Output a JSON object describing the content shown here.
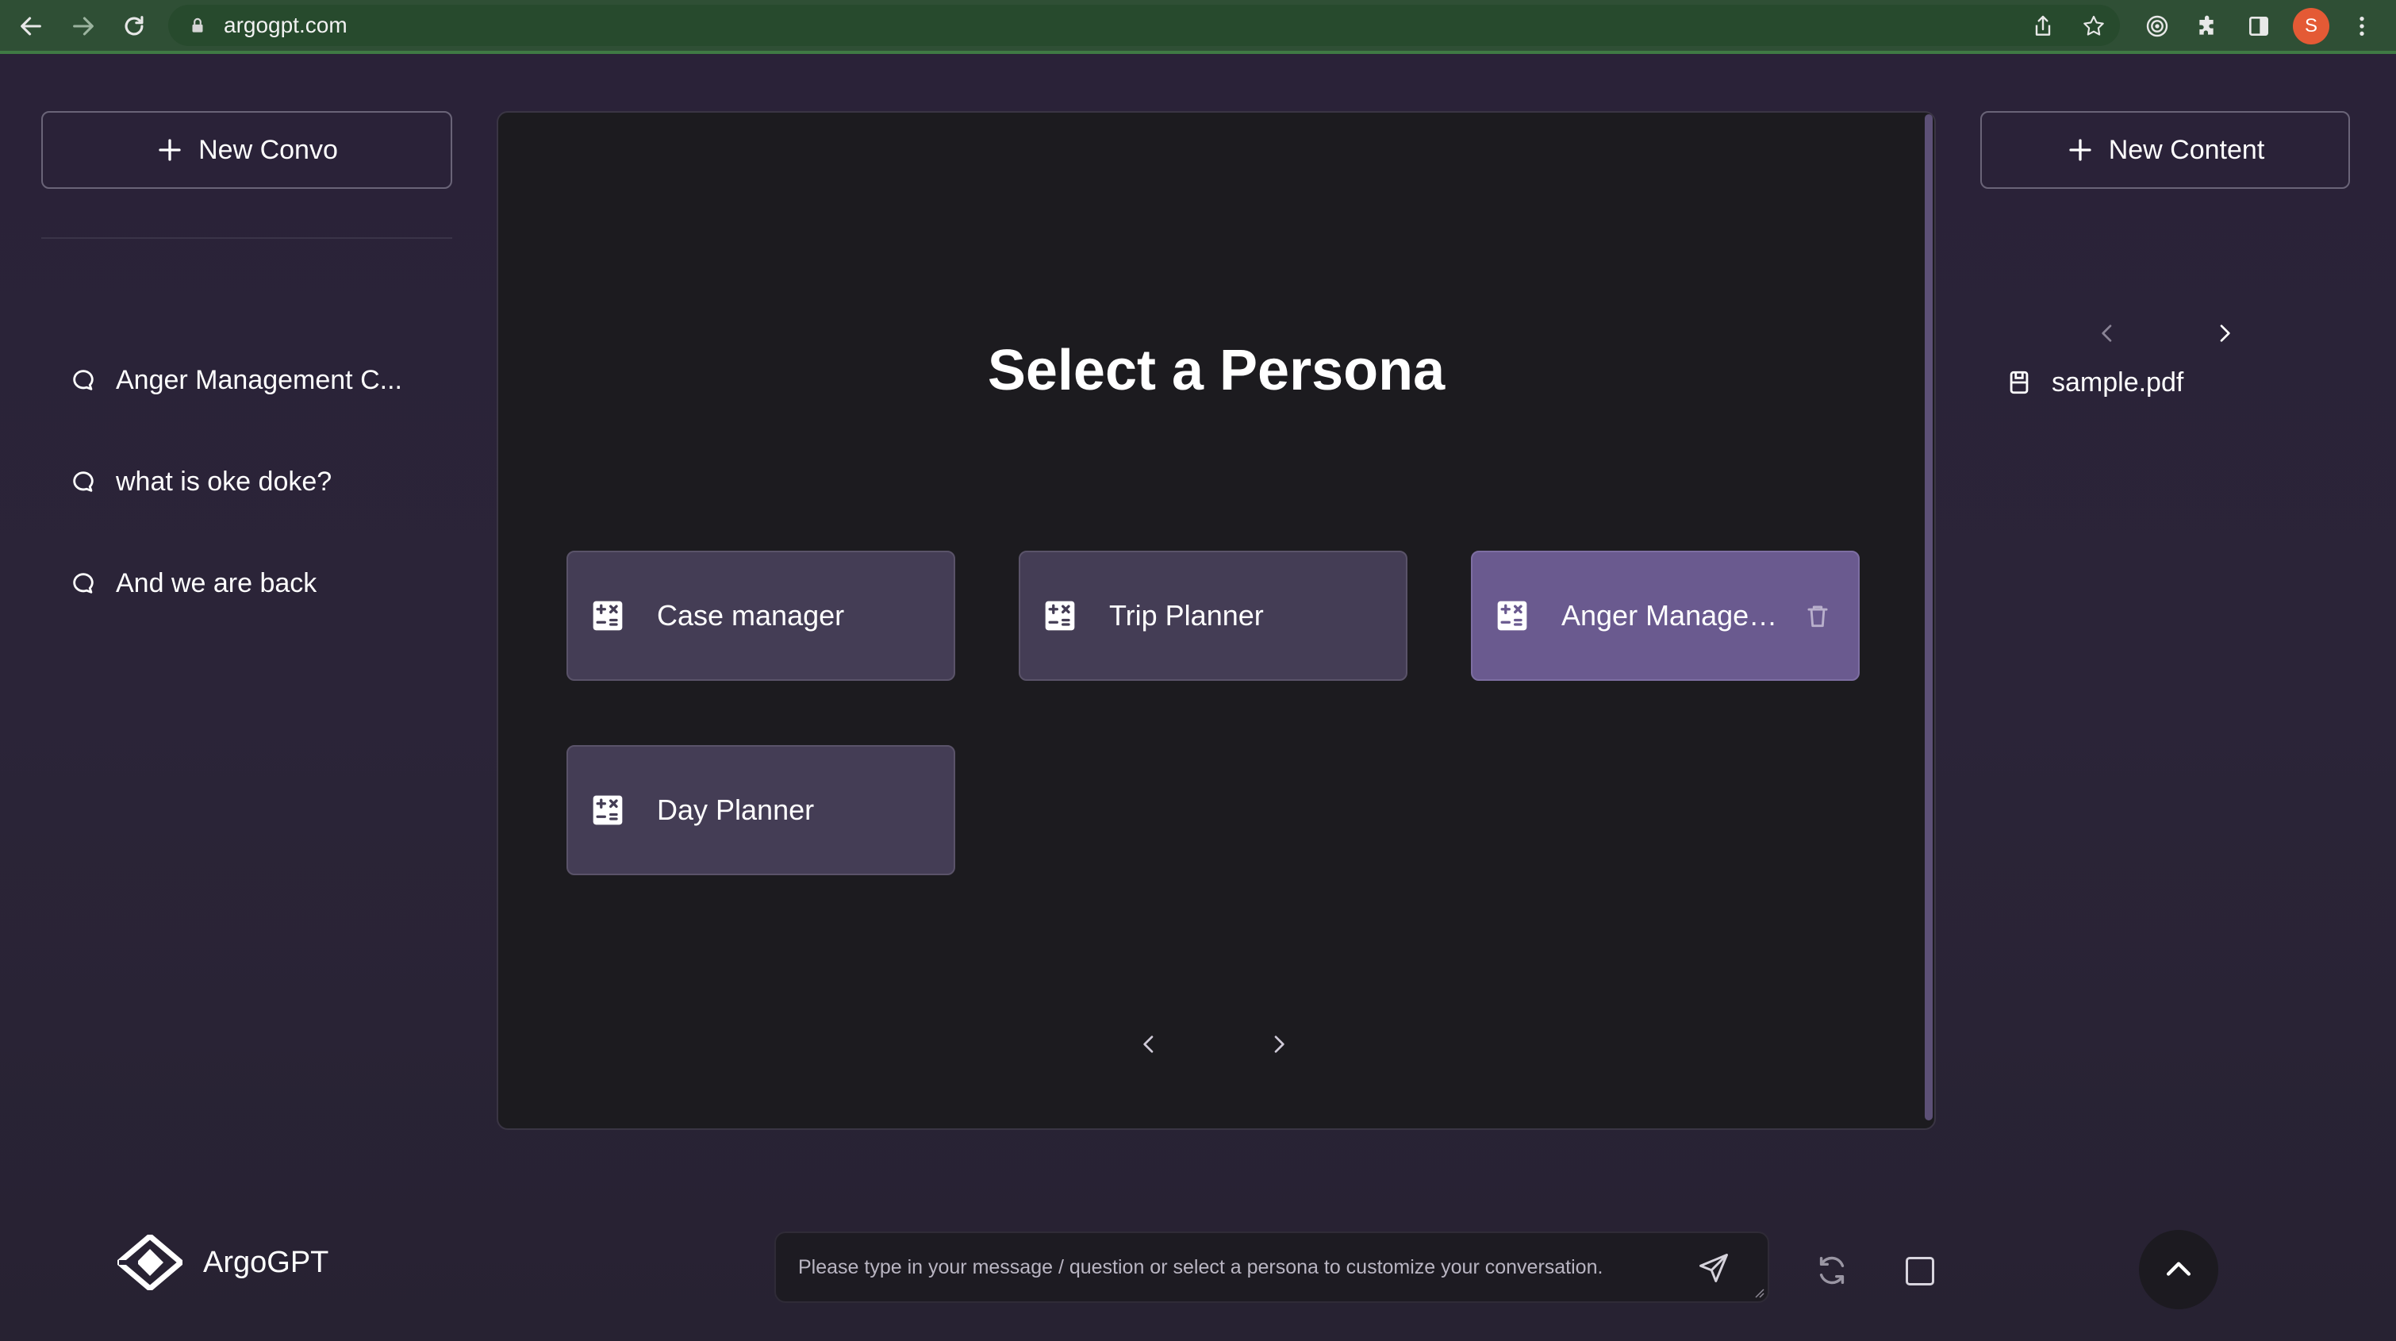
{
  "browser": {
    "url": "argogpt.com",
    "profile_initial": "S"
  },
  "sidebar": {
    "new_convo_label": "New Convo",
    "conversations": [
      {
        "label": "Anger Management C..."
      },
      {
        "label": "what is oke doke?"
      },
      {
        "label": "And we are back"
      }
    ]
  },
  "main": {
    "title": "Select a Persona",
    "personas": [
      {
        "label": "Case manager",
        "selected": false
      },
      {
        "label": "Trip Planner",
        "selected": false
      },
      {
        "label": "Anger Manageme...",
        "selected": true
      },
      {
        "label": "Day Planner",
        "selected": false
      }
    ]
  },
  "content_panel": {
    "new_content_label": "New Content",
    "files": [
      {
        "label": "sample.pdf"
      }
    ]
  },
  "footer": {
    "brand": "ArgoGPT",
    "message_placeholder": "Please type in your message / question or select a persona to customize your conversation."
  },
  "colors": {
    "background": "#2a2238",
    "panel": "#1c1b1f",
    "card": "#443d55",
    "card_selected": "#6a5a8f",
    "browser_bar": "#2f4f35"
  }
}
